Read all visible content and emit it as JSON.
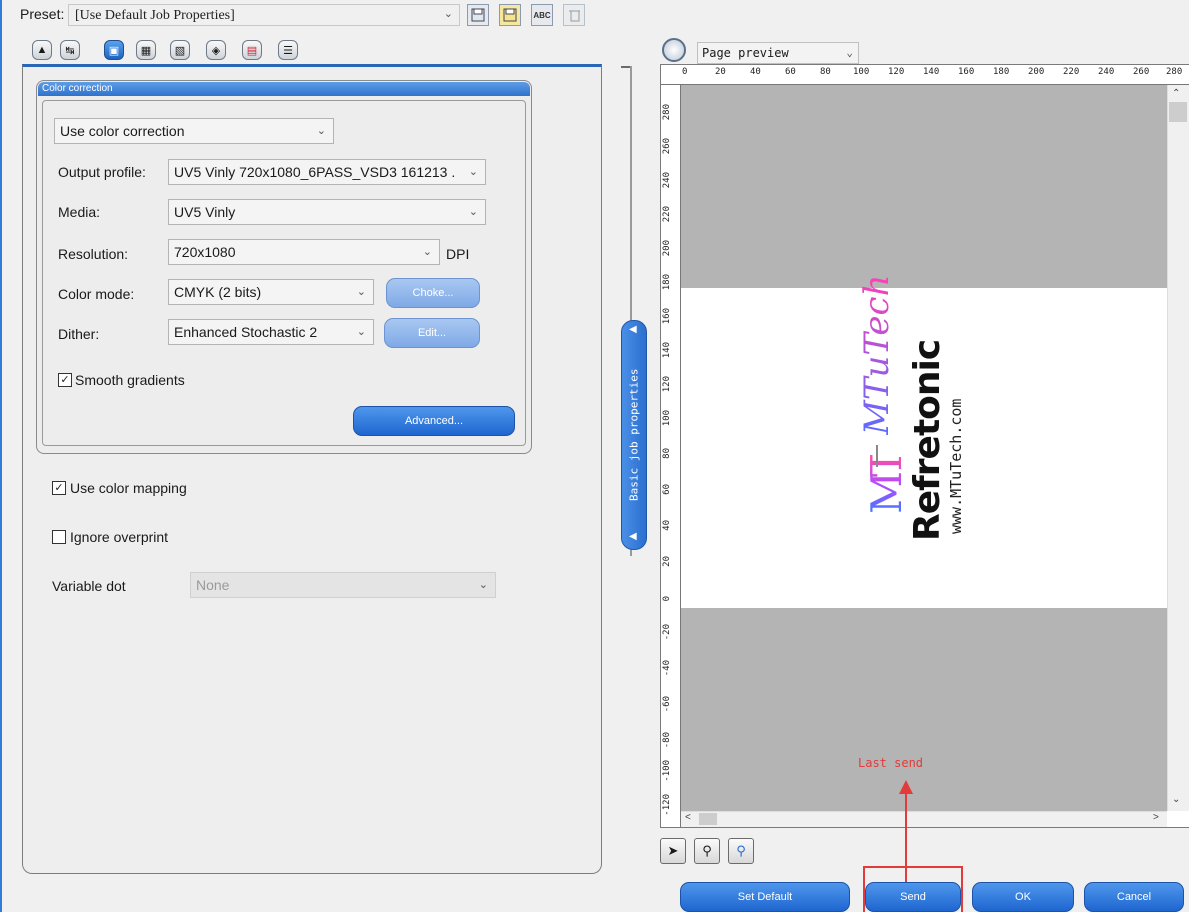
{
  "preset": {
    "label": "Preset:",
    "value": "[Use Default Job Properties]"
  },
  "toolbar_icons": [
    "save-icon",
    "save-as-icon",
    "spellcheck-icon",
    "delete-icon"
  ],
  "toolbar_abc": "ABC",
  "tabs": [
    {
      "icon": "job-icon",
      "active": false
    },
    {
      "icon": "layout-icon",
      "active": false
    },
    {
      "icon": "color-icon",
      "active": true
    },
    {
      "icon": "film-icon",
      "active": false
    },
    {
      "icon": "grid-icon",
      "active": false
    },
    {
      "icon": "marks-icon",
      "active": false
    },
    {
      "icon": "palette-icon",
      "active": false
    },
    {
      "icon": "layers-icon",
      "active": false
    }
  ],
  "color_correction": {
    "group_title": "Color correction",
    "mode": "Use color correction",
    "output_profile_label": "Output profile:",
    "output_profile": "UV5 Vinly 720x1080_6PASS_VSD3 161213 .",
    "media_label": "Media:",
    "media": "UV5 Vinly",
    "resolution_label": "Resolution:",
    "resolution": "720x1080",
    "resolution_unit": "DPI",
    "color_mode_label": "Color mode:",
    "color_mode": "CMYK (2 bits)",
    "choke_button": "Choke...",
    "dither_label": "Dither:",
    "dither": "Enhanced Stochastic 2",
    "edit_button": "Edit...",
    "smooth_gradients_label": "Smooth gradients",
    "smooth_gradients": true,
    "advanced_button": "Advanced..."
  },
  "options": {
    "use_color_mapping_label": "Use color mapping",
    "use_color_mapping": true,
    "ignore_overprint_label": "Ignore overprint",
    "ignore_overprint": false,
    "variable_dot_label": "Variable dot",
    "variable_dot": "None"
  },
  "splitter": {
    "label": "Basic job properties"
  },
  "preview": {
    "mode": "Page preview",
    "hruler": [
      "0",
      "20",
      "40",
      "60",
      "80",
      "100",
      "120",
      "140",
      "160",
      "180",
      "200",
      "220",
      "240",
      "260",
      "280"
    ],
    "vruler": [
      "280",
      "260",
      "240",
      "220",
      "200",
      "180",
      "160",
      "140",
      "120",
      "100",
      "80",
      "60",
      "40",
      "20",
      "0",
      "-20",
      "-40",
      "-60",
      "-80",
      "-100",
      "-120"
    ],
    "logo_mt": "MT",
    "logo_mtutech": "MTuTech",
    "logo_refretonic": "Refretonic",
    "logo_url": "www.MTuTech.com",
    "annotation": "Last send"
  },
  "buttons": {
    "set_default": "Set Default",
    "send": "Send",
    "ok": "OK",
    "cancel": "Cancel"
  },
  "colors": {
    "accent": "#2966b8",
    "annotation": "#e23b3b"
  }
}
